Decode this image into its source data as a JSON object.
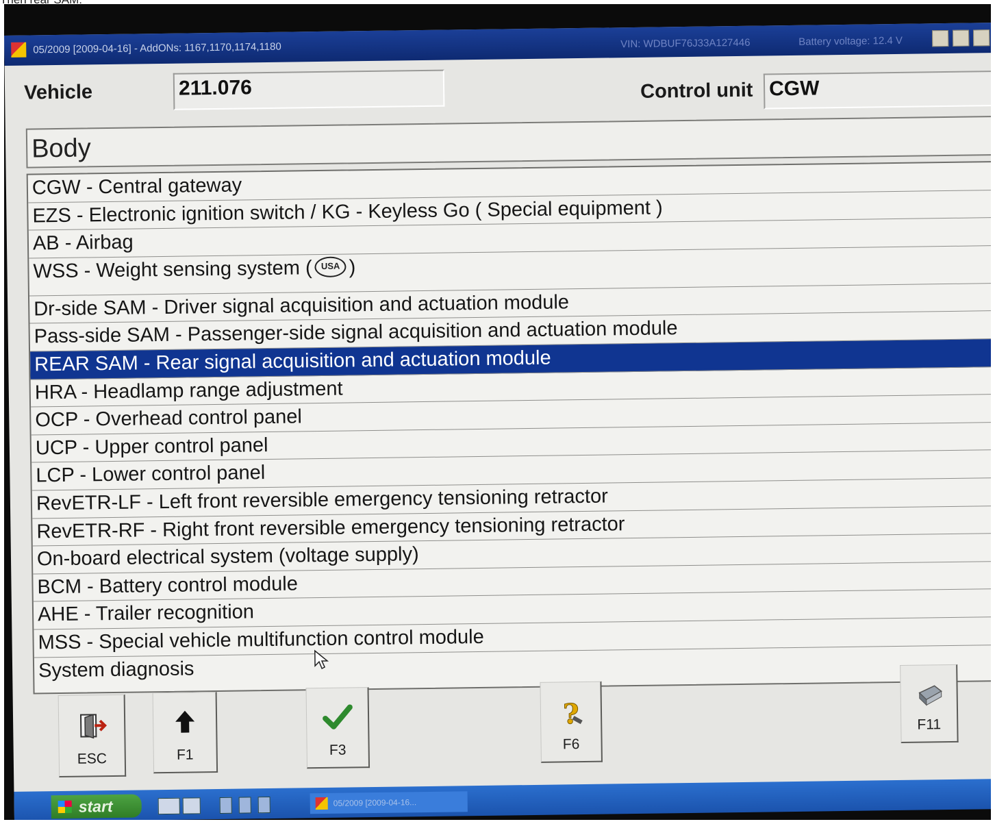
{
  "caption": "Then rear SAM:",
  "window": {
    "title": "05/2009 [2009-04-16] - AddONs: 1167,1170,1174,1180",
    "vin": "VIN: WDBUF76J33A127446",
    "battery": "Battery voltage: 12.4 V"
  },
  "header": {
    "vehicle_label": "Vehicle",
    "vehicle_value": "211.076",
    "control_unit_label": "Control unit",
    "control_unit_value": "CGW"
  },
  "group": {
    "title": "Body"
  },
  "list": {
    "items": [
      "CGW - Central gateway",
      "EZS - Electronic ignition switch / KG - Keyless Go ( Special equipment )",
      "AB - Airbag",
      "WSS - Weight sensing system (",
      "Dr-side SAM - Driver signal acquisition and actuation module",
      "Pass-side SAM - Passenger-side signal acquisition and actuation module",
      "REAR SAM - Rear signal acquisition and actuation module",
      "HRA - Headlamp range adjustment",
      "OCP - Overhead control panel",
      "UCP - Upper control panel",
      "LCP - Lower control panel",
      "RevETR-LF - Left front reversible emergency tensioning retractor",
      "RevETR-RF - Right front reversible emergency tensioning retractor",
      "On-board electrical system (voltage supply)",
      "BCM - Battery control module",
      "AHE - Trailer recognition",
      "MSS - Special vehicle multifunction control module",
      "System diagnosis"
    ],
    "wss_badge": "USA",
    "wss_suffix": ")",
    "selected_index": 6
  },
  "function_keys": {
    "esc": "ESC",
    "f1": "F1",
    "f3": "F3",
    "f6": "F6",
    "f11": "F11"
  },
  "taskbar": {
    "start": "start",
    "task": "05/2009 [2009-04-16..."
  },
  "colors": {
    "selection": "#103591",
    "titlebar": "#1b3f97",
    "check": "#2e8a2e"
  }
}
